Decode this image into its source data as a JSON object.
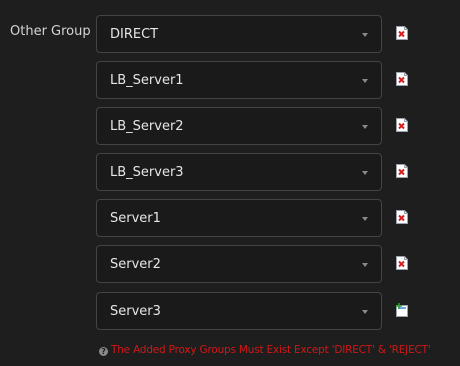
{
  "group": {
    "label": "Other Group",
    "rows": [
      {
        "value": "DIRECT",
        "action": "delete-icon"
      },
      {
        "value": "LB_Server1",
        "action": "delete-icon"
      },
      {
        "value": "LB_Server2",
        "action": "delete-icon"
      },
      {
        "value": "LB_Server3",
        "action": "delete-icon"
      },
      {
        "value": "Server1",
        "action": "delete-icon"
      },
      {
        "value": "Server2",
        "action": "delete-icon"
      },
      {
        "value": "Server3",
        "action": "add-icon"
      }
    ]
  },
  "help": {
    "icon": "help-icon",
    "text": "The Added Proxy Groups Must Exist Except 'DIRECT' & 'REJECT'"
  },
  "colors": {
    "background": "#1e1e1e",
    "border": "#444444",
    "warning": "#d01818",
    "delete": "#d32020"
  }
}
